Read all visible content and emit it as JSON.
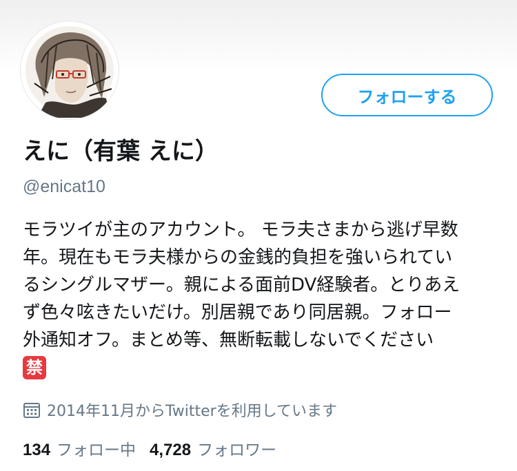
{
  "profile": {
    "follow_button_label": "フォローする",
    "display_name": "えに（有葉 えに）",
    "handle": "@enicat10",
    "bio_lines": [
      "モラツイが主のアカウント。 モラ夫さまから逃げ早数",
      "年。現在もモラ夫様からの金銭的負担を強いられてい",
      "るシングルマザー。親による面前DV経験者。とりあえ",
      "ず色々呟きたいだけ。別居親であり同居親。フォロー",
      "外通知オフ。まとめ等、無断転載しないでください"
    ],
    "bio_emoji": "禁",
    "joined_text": "2014年11月からTwitterを利用しています",
    "following_count": "134",
    "following_label": "フォロー中",
    "followers_count": "4,728",
    "followers_label": "フォロワー"
  },
  "icons": {
    "joined": "calendar-icon",
    "avatar": "user-avatar-illustration"
  },
  "colors": {
    "accent": "#1da1f2",
    "secondary_text": "#657786",
    "primary_text": "#14171a",
    "ban_emoji_bg": "#e8393e"
  }
}
